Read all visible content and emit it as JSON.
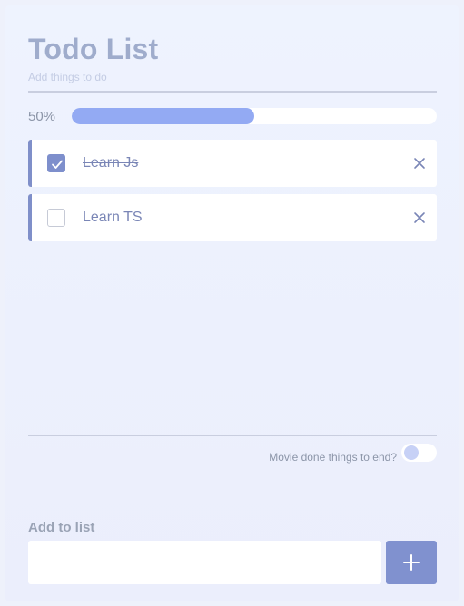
{
  "app": {
    "title": "Todo List",
    "subtitle": "Add things to do"
  },
  "progress": {
    "label": "50%",
    "fraction": 0.5
  },
  "todos": [
    {
      "text": "Learn Js",
      "done": true
    },
    {
      "text": "Learn TS",
      "done": false
    }
  ],
  "settings": {
    "move_done_label": "Movie done things to end?",
    "move_done_enabled": false
  },
  "add": {
    "label": "Add to list",
    "input_value": "",
    "input_placeholder": ""
  },
  "icons": {
    "check": "check-icon",
    "delete": "close-icon",
    "add": "plus-icon"
  },
  "colors": {
    "accent": "#8091cf",
    "progress_fill": "#93aaf3",
    "title": "#9faccc"
  }
}
